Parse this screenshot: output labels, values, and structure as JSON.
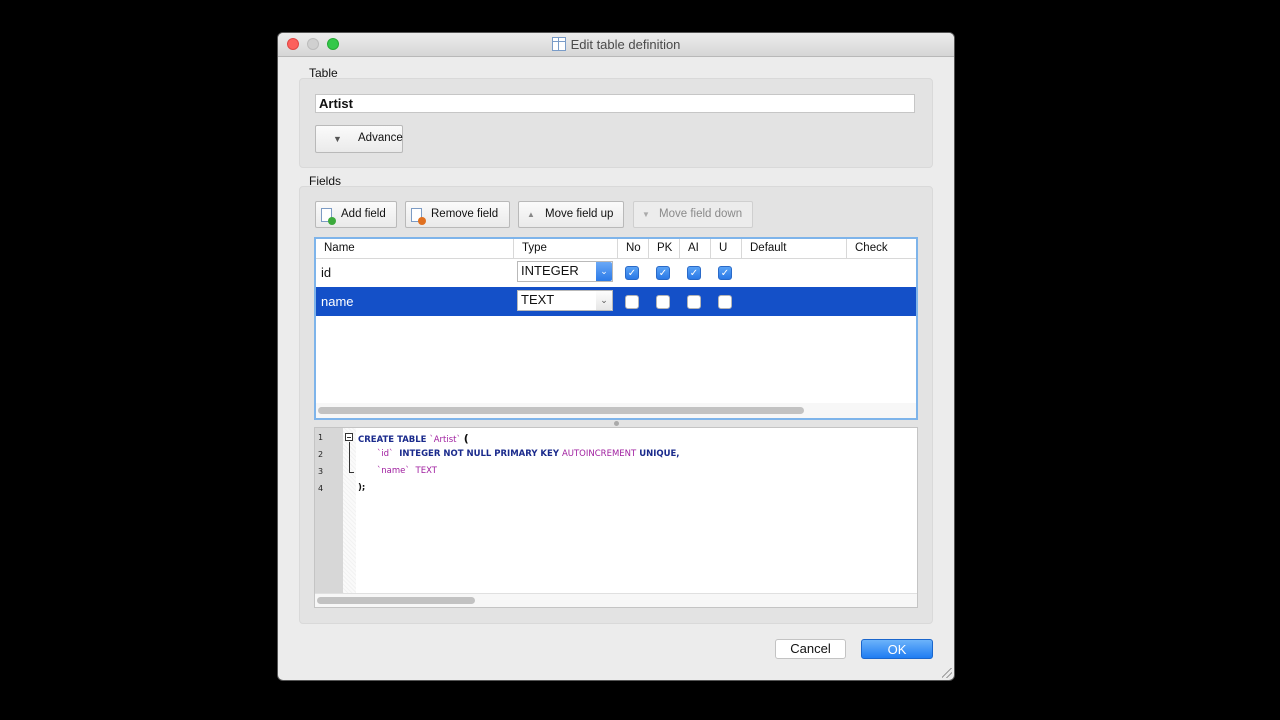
{
  "window": {
    "title": "Edit table definition"
  },
  "table_group": {
    "label": "Table",
    "name_value": "Artist",
    "advance_label": "Advance"
  },
  "fields_group": {
    "label": "Fields",
    "toolbar": {
      "add_label": "Add field",
      "remove_label": "Remove field",
      "up_label": "Move field up",
      "down_label": "Move field down"
    },
    "columns": [
      "Name",
      "Type",
      "No",
      "PK",
      "AI",
      "U",
      "Default",
      "Check"
    ],
    "rows": [
      {
        "name": "id",
        "type": "INTEGER",
        "not_null": true,
        "pk": true,
        "ai": true,
        "unique": true,
        "selected": false
      },
      {
        "name": "name",
        "type": "TEXT",
        "not_null": false,
        "pk": false,
        "ai": false,
        "unique": false,
        "selected": true
      }
    ]
  },
  "sql": {
    "line_numbers": [
      "1",
      "2",
      "3",
      "4"
    ],
    "l1_kw": "CREATE TABLE",
    "l1_ident": "`Artist`",
    "l1_paren": "(",
    "l2_ident": "`id`",
    "l2_kw": "INTEGER NOT NULL PRIMARY KEY",
    "l2_ai": "AUTOINCREMENT",
    "l2_tail": "UNIQUE,",
    "l3_ident": "`name`",
    "l3_type": "TEXT",
    "l4": ");"
  },
  "buttons": {
    "cancel": "Cancel",
    "ok": "OK"
  },
  "colors": {
    "selection": "#1450c8",
    "accent": "#2a78e6"
  }
}
